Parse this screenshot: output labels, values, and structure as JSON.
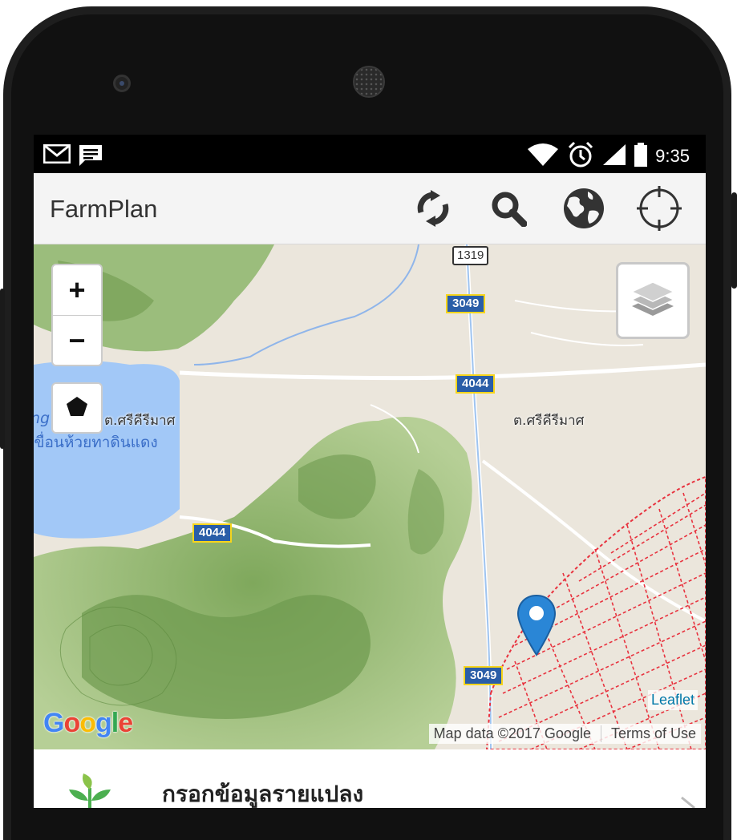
{
  "status_bar": {
    "time": "9:35",
    "left_icons": [
      "gmail-icon",
      "message-icon"
    ],
    "right_icons": [
      "wifi-icon",
      "alarm-icon",
      "signal-icon",
      "battery-icon"
    ]
  },
  "app_bar": {
    "title": "FarmPlan",
    "actions": [
      "sync-icon",
      "search-icon",
      "globe-icon",
      "locate-icon"
    ]
  },
  "map": {
    "zoom_in_label": "+",
    "zoom_out_label": "−",
    "road_shields": {
      "r1319": "1319",
      "r3049_top": "3049",
      "r4044_top": "4044",
      "r4044_left": "4044",
      "r3049_bottom": "3049"
    },
    "labels": {
      "place_left": "ต.ศรีคีรีมาศ",
      "place_right": "ต.ศรีคีรีมาศ",
      "water_prefix": "ng",
      "water_name": "เขื่อนห้วยทาดินแดง"
    },
    "google_logo": "Google",
    "leaflet_link": "Leaflet",
    "attribution": {
      "map_data": "Map data ©2017 Google",
      "terms": "Terms of Use"
    },
    "colors": {
      "land": "#ebe6dc",
      "water": "#a2c8f7",
      "forest": "#93b872",
      "parcel_lines": "#e8323e",
      "marker": "#2a86d6"
    }
  },
  "bottom_panel": {
    "title": "กรอกข้อมูลรายแปลง",
    "icon": "plant-icon"
  }
}
